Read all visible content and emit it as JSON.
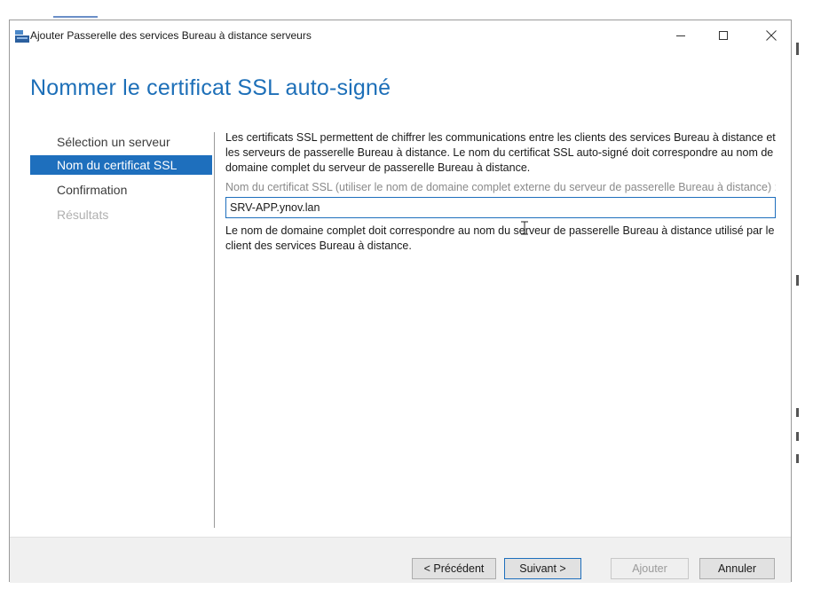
{
  "window": {
    "title": "Ajouter Passerelle des services Bureau à distance serveurs",
    "icon": "server-manager-icon",
    "controls": [
      "minimize",
      "maximize",
      "close"
    ]
  },
  "page": {
    "heading": "Nommer le certificat SSL auto-signé"
  },
  "nav": {
    "items": [
      {
        "label": "Sélection un serveur",
        "state": "normal"
      },
      {
        "label": "Nom du certificat SSL",
        "state": "active"
      },
      {
        "label": "Confirmation",
        "state": "normal"
      },
      {
        "label": "Résultats",
        "state": "disabled"
      }
    ]
  },
  "content": {
    "description": "Les certificats SSL permettent de chiffrer les communications entre les clients des services Bureau à distance et les serveurs de passerelle Bureau à distance. Le nom du certificat SSL auto-signé doit correspondre au nom de domaine complet du serveur de passerelle Bureau à distance.",
    "field_label": "Nom du certificat SSL (utiliser le nom de domaine complet externe du serveur de passerelle Bureau à distance) :",
    "field_value": "SRV-APP.ynov.lan",
    "note": "Le nom de domaine complet doit correspondre au nom du serveur de passerelle Bureau à distance utilisé par le client des services Bureau à distance."
  },
  "footer": {
    "previous_label": "< Précédent",
    "next_label": "Suivant >",
    "add_label": "Ajouter",
    "cancel_label": "Annuler"
  },
  "colors": {
    "accent": "#1e6fbd",
    "heading": "#1d6fb8",
    "footer_bg": "#f0f0f0"
  }
}
